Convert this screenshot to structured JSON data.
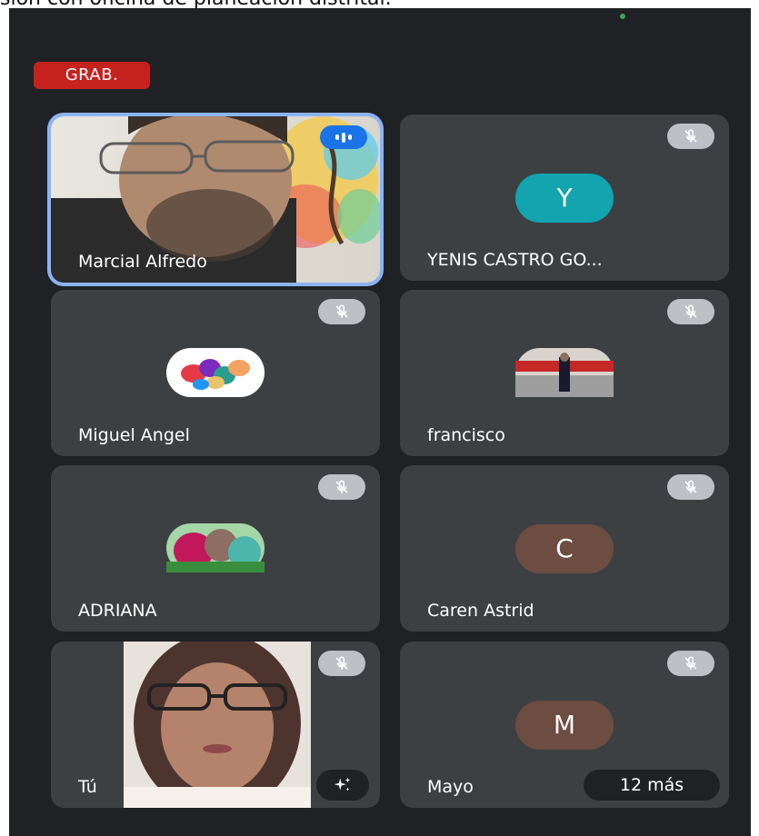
{
  "caption": "sión con oficina de planeación distrital.",
  "recording": {
    "label": "GRAB."
  },
  "participants": [
    {
      "name": "Marcial Alfredo",
      "type": "video",
      "speaking": true
    },
    {
      "name": "YENIS CASTRO GO...",
      "type": "initial",
      "initial": "Y",
      "color": "#12a4af",
      "muted": true
    },
    {
      "name": "Miguel Angel",
      "type": "logo",
      "muted": true
    },
    {
      "name": "francisco",
      "type": "photo",
      "muted": true
    },
    {
      "name": "ADRIANA",
      "type": "photo",
      "muted": true
    },
    {
      "name": "Caren Astrid",
      "type": "initial",
      "initial": "C",
      "color": "#6d4c41",
      "muted": true
    },
    {
      "name": "Tú",
      "type": "self-video",
      "muted": true
    },
    {
      "name": "Mayo",
      "type": "initial",
      "initial": "M",
      "color": "#6d4c41",
      "muted": true
    }
  ],
  "more": {
    "label": "12 más"
  },
  "icons": [
    "mic-off-icon",
    "speaking-indicator-icon",
    "sparkle-effects-icon"
  ]
}
